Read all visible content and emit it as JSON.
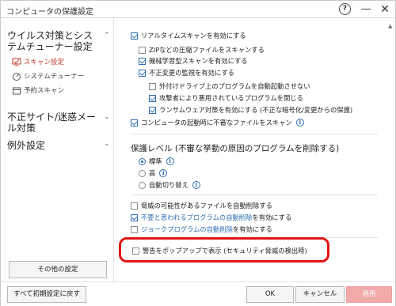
{
  "window": {
    "title": "コンピュータの保護設定",
    "help_glyph": "?",
    "minimize_glyph": "—",
    "close_glyph": "✕"
  },
  "sidebar": {
    "section1": "ウイルス対策とシステムチューナー設定",
    "section1_chevron": "⌃",
    "items": [
      {
        "label": "スキャン設定",
        "icon": "scan-settings-icon",
        "active": true
      },
      {
        "label": "システムチューナー",
        "icon": "gauge-icon",
        "active": false
      },
      {
        "label": "予約スキャン",
        "icon": "calendar-icon",
        "active": false
      }
    ],
    "section2": "不正サイト/迷惑メール対策",
    "section2_chevron": "⌄",
    "section3": "例外設定",
    "section3_chevron": "⌄",
    "other_button": "その他の設定"
  },
  "main": {
    "realtime": "リアルタイムスキャンを有効にする",
    "zip": "ZIPなどの圧縮ファイルをスキャンする",
    "ml": "機械学習型スキャンを有効にする",
    "tamper": "不正変更の監視を有効にする",
    "external": "外付けドライブ上のプログラムを自動起動させない",
    "attacker": "攻撃者により悪用されているプログラムを閉じる",
    "ransom": "ランサムウェア対策を有効にする (不正な暗号化/変更からの保護)",
    "startup": "コンピュータの起動時に不審なファイルをスキャン",
    "protection_heading": "保護レベル (不審な挙動の原因のプログラムを削除する)",
    "level_standard": "標準",
    "level_high": "高",
    "level_auto": "自動切り替え",
    "threat_delete": "脅威の可能性があるファイルを自動削除する",
    "unwanted_link": "不要と思われるプログラムの自動削除",
    "unwanted_suffix": "を有効にする",
    "joke_link": "ジョークプログラムの自動削除",
    "joke_suffix": "を有効にする",
    "popup": "警告をポップアップで表示 (セキュリティ脅威の検出時)"
  },
  "footer": {
    "reset": "すべて初期設定に戻す",
    "ok": "OK",
    "cancel": "キャンセル",
    "apply": "適用"
  },
  "colors": {
    "accent": "#2e6fb3",
    "highlight": "#e01515",
    "apply_disabled": "#f2a9a9",
    "active_item": "#c0392b"
  }
}
